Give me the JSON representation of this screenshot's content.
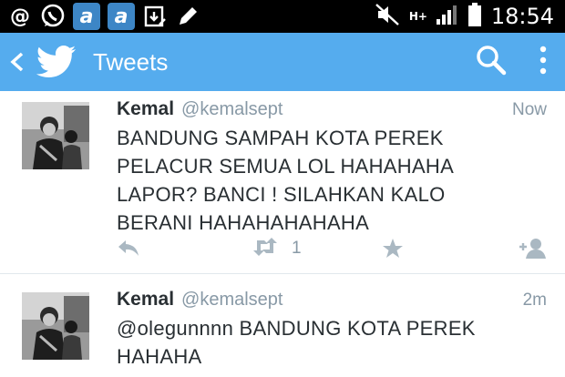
{
  "status_bar": {
    "time": "18:54",
    "network": "H+",
    "icons": [
      "at-icon",
      "whatsapp-icon",
      "app-a-icon",
      "app-a-icon",
      "download-icon",
      "edit-icon",
      "mute-icon",
      "signal-icon",
      "battery-icon"
    ],
    "app_letter": "a"
  },
  "header": {
    "title": "Tweets",
    "accent": "#55acee"
  },
  "tweets": [
    {
      "name": "Kemal",
      "handle": "@kemalsept",
      "time": "Now",
      "lines": [
        "BANDUNG SAMPAH KOTA PEREK",
        "PELACUR SEMUA LOL HAHAHAHA",
        "LAPOR? BANCI ! SILAHKAN KALO",
        "BERANI HAHAHAHAHAHA"
      ],
      "retweet_count": "1"
    },
    {
      "name": "Kemal",
      "handle": "@kemalsept",
      "time": "2m",
      "lines": [
        "@olegunnnn BANDUNG KOTA PEREK",
        "HAHAHA"
      ]
    }
  ]
}
